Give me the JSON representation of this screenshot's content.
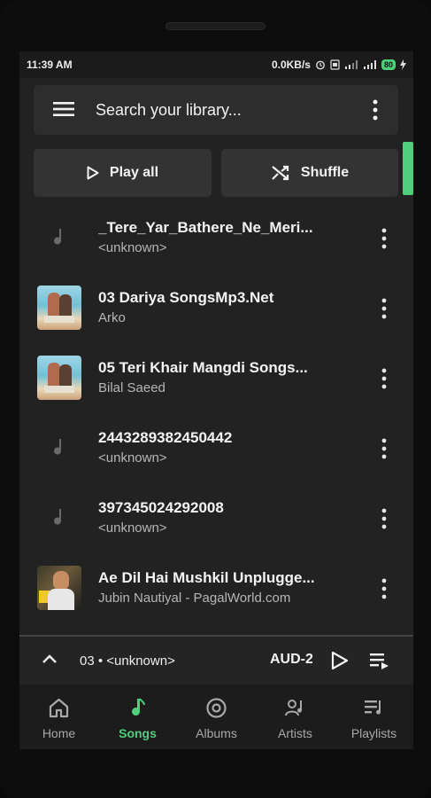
{
  "status_bar": {
    "time": "11:39 AM",
    "speed": "0.0KB/s",
    "battery": "80"
  },
  "search": {
    "placeholder": "Search your library..."
  },
  "actions": {
    "play_all": "Play all",
    "shuffle": "Shuffle"
  },
  "songs": [
    {
      "title": "_Tere_Yar_Bathere_Ne_Meri...",
      "artist": "<unknown>",
      "art": "music-note-icon"
    },
    {
      "title": "03 Dariya SongsMp3.Net",
      "artist": "Arko",
      "art": "album-art"
    },
    {
      "title": "05 Teri Khair Mangdi Songs...",
      "artist": "Bilal Saeed",
      "art": "album-art"
    },
    {
      "title": "2443289382450442",
      "artist": "<unknown>",
      "art": "music-note-icon"
    },
    {
      "title": "397345024292008",
      "artist": "<unknown>",
      "art": "music-note-icon"
    },
    {
      "title": "Ae Dil Hai Mushkil Unplugge...",
      "artist": "Jubin Nautiyal - PagalWorld.com",
      "art": "album-art"
    }
  ],
  "mini_player": {
    "subtitle": "03 • <unknown>",
    "title": "AUD-2"
  },
  "nav": [
    {
      "label": "Home",
      "icon": "home-icon",
      "active": false
    },
    {
      "label": "Songs",
      "icon": "music-note-icon",
      "active": true
    },
    {
      "label": "Albums",
      "icon": "album-icon",
      "active": false
    },
    {
      "label": "Artists",
      "icon": "artist-icon",
      "active": false
    },
    {
      "label": "Playlists",
      "icon": "playlist-icon",
      "active": false
    }
  ],
  "colors": {
    "accent": "#4fd07e",
    "background": "#222222",
    "surface": "#2d2d2d"
  }
}
